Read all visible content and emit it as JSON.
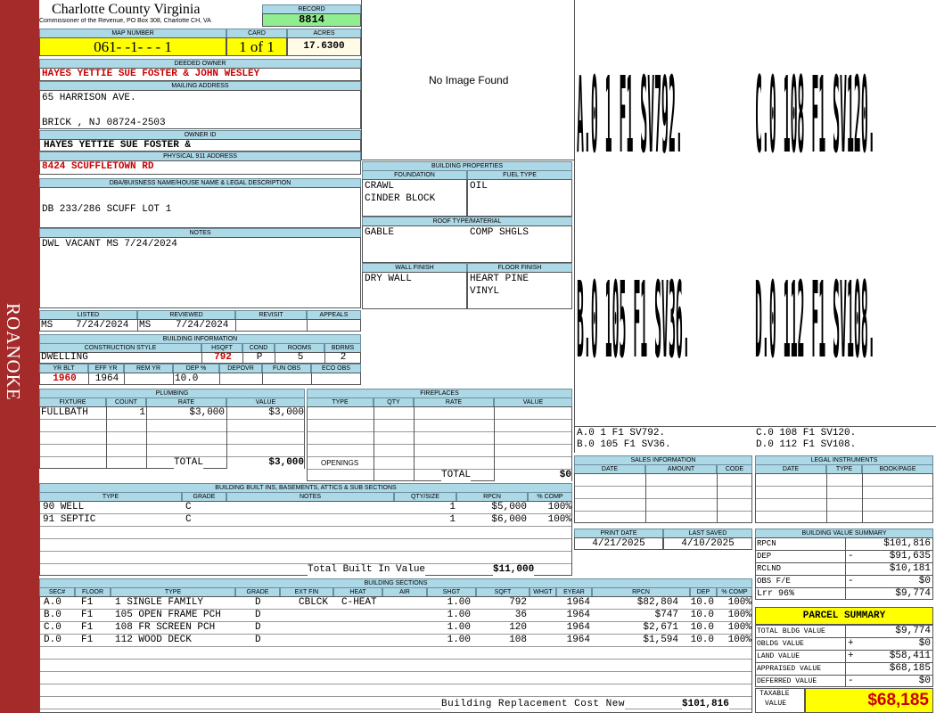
{
  "sidebar": {
    "label": "ROANOKE"
  },
  "header": {
    "county": "Charlotte County Virginia",
    "commissioner": "Commissioner of the Revenue, PO Box 308, Charlotte CH, VA",
    "record_label": "RECORD",
    "record": "8814",
    "map_label": "MAP NUMBER",
    "map": "061- -1- - - 1",
    "card_label": "CARD",
    "card": "1 of 1",
    "acres_label": "ACRES",
    "acres": "17.6300"
  },
  "owner": {
    "deeded_label": "DEEDED OWNER",
    "deeded": "HAYES YETTIE SUE FOSTER & JOHN WESLEY",
    "mailing_label": "MAILING ADDRESS",
    "mail1": "65 HARRISON AVE.",
    "mail2": "BRICK , NJ 08724-2503",
    "owner_id_label": "OWNER ID",
    "owner_id": "HAYES YETTIE SUE FOSTER &",
    "phys_label": "PHYSICAL 911 ADDRESS",
    "phys": "8424 SCUFFLETOWN RD",
    "dba_label": "DBA/BUISNESS NAME/HOUSE NAME & LEGAL DESCRIPTION",
    "dba": "DB 233/286 SCUFF LOT 1",
    "notes_label": "NOTES",
    "notes": "DWL VACANT   MS 7/24/2024"
  },
  "photo": {
    "text": "No Image Found"
  },
  "building_props": {
    "title": "BUILDING PROPERTIES",
    "foundation_label": "FOUNDATION",
    "foundation1": "CRAWL",
    "foundation2": "CINDER BLOCK",
    "fuel_label": "FUEL TYPE",
    "fuel": "OIL",
    "roof_label": "ROOF TYPE/MATERIAL",
    "roof_type": "GABLE",
    "roof_mat": "COMP SHGLS",
    "wall_label": "WALL FINISH",
    "wall": "DRY WALL",
    "floor_label": "FLOOR FINISH",
    "floor1": "HEART PINE",
    "floor2": "VINYL"
  },
  "review": {
    "listed_label": "LISTED",
    "reviewed_label": "REVIEWED",
    "revisit_label": "REVISIT",
    "appeals_label": "APPEALS",
    "listed_by": "MS",
    "listed_date": "7/24/2024",
    "reviewed_by": "MS",
    "reviewed_date": "7/24/2024"
  },
  "bldg_info": {
    "title": "BUILDING INFORMATION",
    "style_label": "CONSTRUCTION STYLE",
    "hsqft_label": "HSQFT",
    "cond_label": "COND",
    "rooms_label": "ROOMS",
    "bdrms_label": "BDRMS",
    "style": "DWELLING",
    "hsqft": "792",
    "cond": "P",
    "rooms": "5",
    "bdrms": "2",
    "yrblt_label": "YR BLT",
    "effyr_label": "EFF YR",
    "remyr_label": "REM YR",
    "dep_label": "DEP %",
    "depovr_label": "DEPOVR",
    "funobs_label": "FUN OBS",
    "ecoobs_label": "ECO OBS",
    "yrblt": "1960",
    "effyr": "1964",
    "dep": "10.0"
  },
  "plumbing": {
    "title": "PLUMBING",
    "fixture_label": "FIXTURE",
    "count_label": "COUNT",
    "rate_label": "RATE",
    "value_label": "VALUE",
    "fixture": "FULLBATH",
    "count": "1",
    "rate": "$3,000",
    "value": "$3,000",
    "total_label": "TOTAL",
    "total": "$3,000"
  },
  "fireplaces": {
    "title": "FIREPLACES",
    "type_label": "TYPE",
    "qty_label": "QTY",
    "rate_label": "RATE",
    "value_label": "VALUE",
    "openings_label": "OPENINGS",
    "total_label": "TOTAL",
    "total": "$0"
  },
  "builtins": {
    "title": "BUILDING BUILT INS, BASEMENTS, ATTICS & SUB SECTIONS",
    "headers": [
      "TYPE",
      "GRADE",
      "NOTES",
      "QTY/SIZE",
      "RPCN",
      "% COMP"
    ],
    "rows": [
      [
        "90 WELL",
        "C",
        "",
        "1",
        "$5,000",
        "100%"
      ],
      [
        "91 SEPTIC",
        "C",
        "",
        "1",
        "$6,000",
        "100%"
      ]
    ],
    "total_label": "Total Built In Value",
    "total": "$11,000"
  },
  "sections": {
    "title": "BUILDING SECTIONS",
    "headers": [
      "SEC#",
      "FLOOR",
      "TYPE",
      "GRADE",
      "EXT FIN",
      "HEAT",
      "AIR",
      "SHGT",
      "SQFT",
      "WHGT",
      "EYEAR",
      "RPCN",
      "DEP",
      "% COMP"
    ],
    "rows": [
      [
        "A.0",
        "F1",
        "1 SINGLE FAMILY",
        "D",
        "CBLCK",
        "C-HEAT",
        "",
        "1.00",
        "792",
        "",
        "1964",
        "$82,804",
        "10.0",
        "100%"
      ],
      [
        "B.0",
        "F1",
        "105 OPEN FRAME PCH",
        "D",
        "",
        "",
        "",
        "1.00",
        "36",
        "",
        "1964",
        "$747",
        "10.0",
        "100%"
      ],
      [
        "C.0",
        "F1",
        "108 FR SCREEN PCH",
        "D",
        "",
        "",
        "",
        "1.00",
        "120",
        "",
        "1964",
        "$2,671",
        "10.0",
        "100%"
      ],
      [
        "D.0",
        "F1",
        "112 WOOD DECK",
        "D",
        "",
        "",
        "",
        "1.00",
        "108",
        "",
        "1964",
        "$1,594",
        "10.0",
        "100%"
      ]
    ],
    "replacement_label": "Building Replacement Cost New",
    "replacement": "$101,816"
  },
  "sketch": {
    "tall": [
      "A.0 1 F1 SV792.",
      "C.0 108 F1 SV120.",
      "B.0 105 F1 SV36.",
      "D.0 112 F1 SV108."
    ],
    "legend1": "A.0   1    F1   SV792.",
    "legend2": "B.0   105  F1   SV36.",
    "legend3": "C.0   108  F1   SV120.",
    "legend4": "D.0   112  F1   SV108."
  },
  "sales": {
    "title": "SALES INFORMATION",
    "date_label": "DATE",
    "amount_label": "AMOUNT",
    "code_label": "CODE"
  },
  "legal": {
    "title": "LEGAL INSTRUMENTS",
    "date_label": "DATE",
    "type_label": "TYPE",
    "bookpage_label": "BOOK/PAGE"
  },
  "dates": {
    "print_label": "PRINT DATE",
    "saved_label": "LAST SAVED",
    "print": "4/21/2025",
    "saved": "4/10/2025"
  },
  "value_summary": {
    "title": "BUILDING VALUE SUMMARY",
    "rows": [
      [
        "RPCN",
        "",
        "$101,816"
      ],
      [
        "DEP",
        "-",
        "$91,635"
      ],
      [
        "RCLND",
        "",
        "$10,181"
      ],
      [
        "OBS F/E",
        "-",
        "$0"
      ],
      [
        "Lrr          96%",
        "",
        "$9,774"
      ]
    ]
  },
  "parcel": {
    "title": "PARCEL SUMMARY",
    "rows": [
      [
        "TOTAL BLDG VALUE",
        "",
        "$9,774"
      ],
      [
        "OBLDG VALUE",
        "+",
        "$0"
      ],
      [
        "LAND VALUE",
        "+",
        "$58,411"
      ],
      [
        "APPRAISED VALUE",
        "",
        "$68,185"
      ],
      [
        "DEFERRED VALUE",
        "-",
        "$0"
      ]
    ],
    "taxable_label1": "TAXABLE",
    "taxable_label2": "VALUE",
    "taxable": "$68,185"
  }
}
